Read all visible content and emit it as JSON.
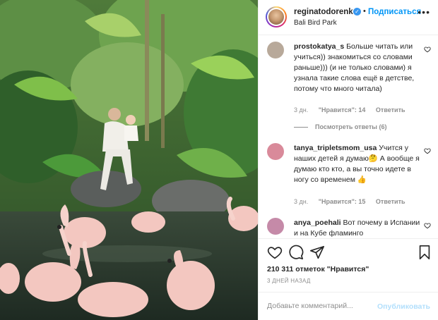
{
  "post": {
    "username": "reginatodorenko",
    "follow_label": "Подписаться",
    "location": "Bali Bird Park",
    "more_icon": "more-horizontal-icon"
  },
  "comments": [
    {
      "username": "prostokatya_s",
      "text": "Больше читать или учиться)) знакомиться со словами раньше))) (и не только словами) я узнала такие слова ещё в детстве, потому что много читала)",
      "time": "3 дн.",
      "likes": "\"Нравится\": 14",
      "reply": "Ответить",
      "view_replies": "Посмотреть ответы (6)",
      "avatar_color": "#b8a99a"
    },
    {
      "username": "tanya_tripletsmom_usa",
      "text": "Учится у наших детей я думаю🤔 А вообще я думаю кто кто, а вы точно идете в ногу со временем 👍",
      "time": "3 дн.",
      "likes": "\"Нравится\": 15",
      "reply": "Ответить",
      "avatar_color": "#d98a9a"
    },
    {
      "username": "anya_poehali",
      "text": "Вот почему в Испании и на Кубе фламинго",
      "avatar_color": "#c58aa8"
    }
  ],
  "actions": {
    "like_icon": "heart-icon",
    "comment_icon": "comment-icon",
    "share_icon": "share-icon",
    "save_icon": "bookmark-icon"
  },
  "likes_text": "210 311 отметок \"Нравится\"",
  "date_text": "3 ДНЕЙ НАЗАД",
  "add_comment": {
    "placeholder": "Добавьте комментарий...",
    "publish_label": "Опубликовать"
  },
  "colors": {
    "accent": "#0095f6",
    "publish_disabled": "#b2dffc",
    "muted": "#8e8e8e"
  }
}
